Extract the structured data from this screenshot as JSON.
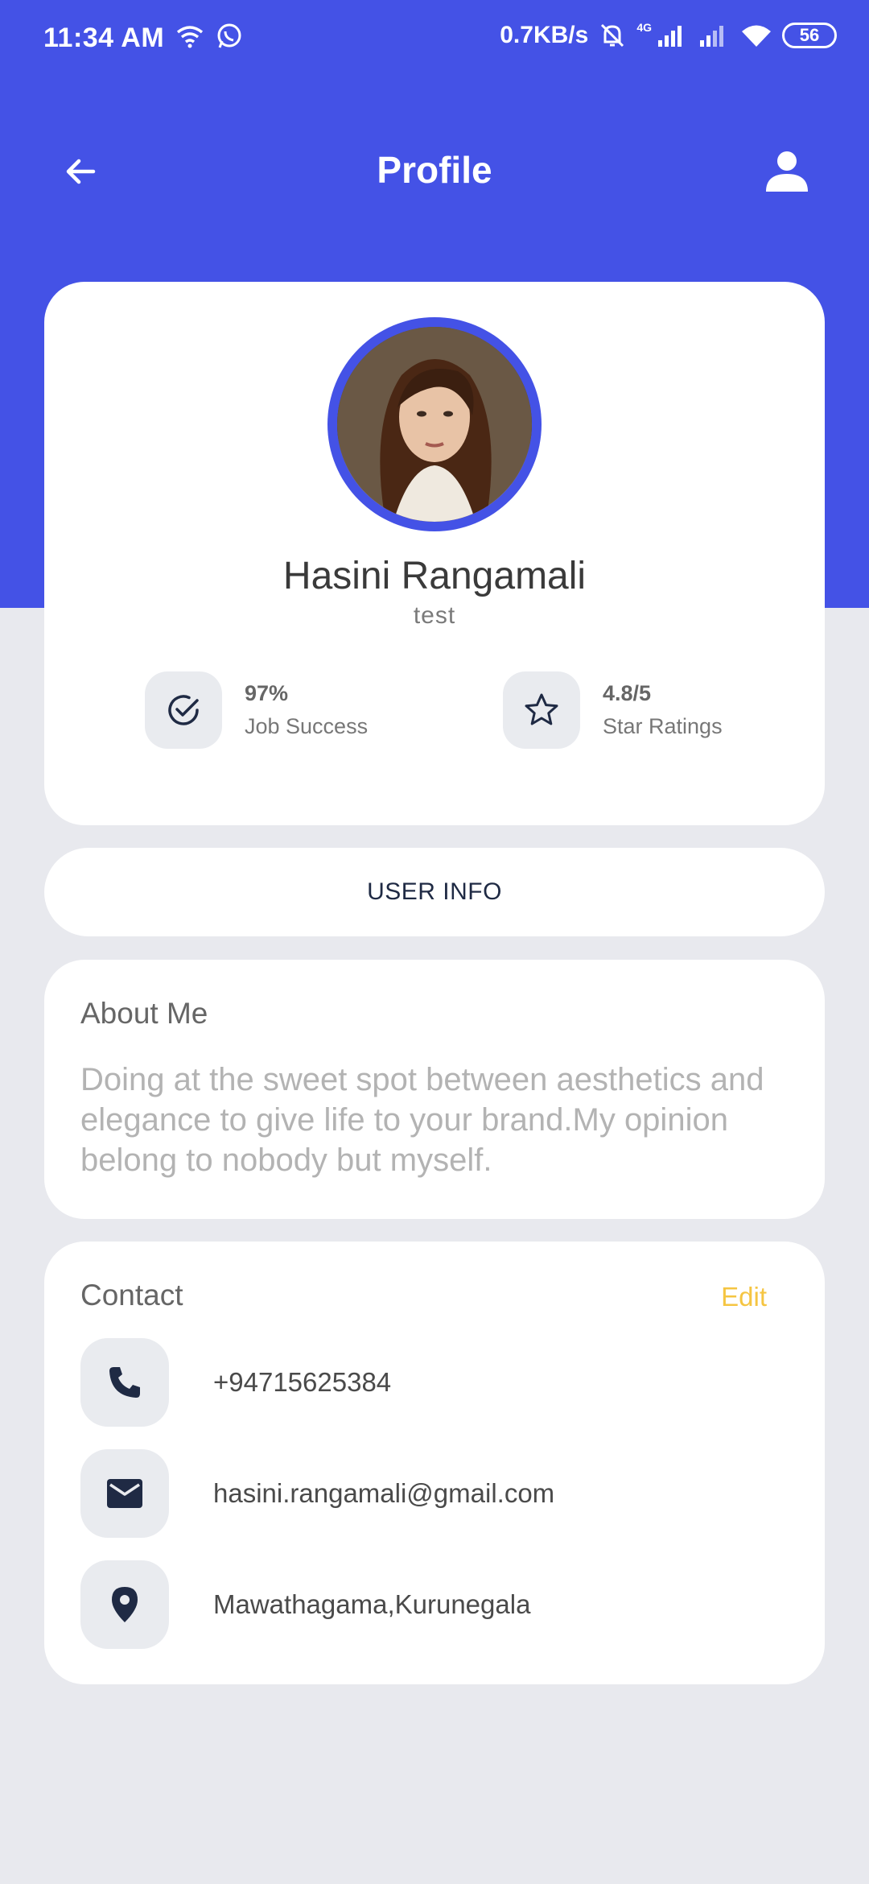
{
  "status_bar": {
    "time": "11:34 AM",
    "speed": "0.7KB/s",
    "network_type": "4G",
    "battery": "56"
  },
  "app_bar": {
    "title": "Profile"
  },
  "profile": {
    "name": "Hasini Rangamali",
    "subtitle": "test",
    "stats": [
      {
        "value": "97%",
        "label": "Job Success",
        "icon": "check-circle-icon"
      },
      {
        "value": "4.8/5",
        "label": "Star Ratings",
        "icon": "star-icon"
      }
    ]
  },
  "user_info": {
    "label": "USER INFO"
  },
  "about": {
    "title": "About Me",
    "text": "Doing at the sweet spot between aesthetics and elegance to give life to your brand.My opinion belong to nobody but myself."
  },
  "contact": {
    "title": "Contact",
    "edit_label": "Edit",
    "items": [
      {
        "icon": "phone-icon",
        "value": "+94715625384"
      },
      {
        "icon": "mail-icon",
        "value": "hasini.rangamali@gmail.com"
      },
      {
        "icon": "location-pin-icon",
        "value": "Mawathagama,Kurunegala"
      }
    ]
  },
  "colors": {
    "primary": "#4452e6",
    "accent_edit": "#f5c542",
    "icon_dark": "#1f2a44",
    "background": "#e8e9ee"
  }
}
